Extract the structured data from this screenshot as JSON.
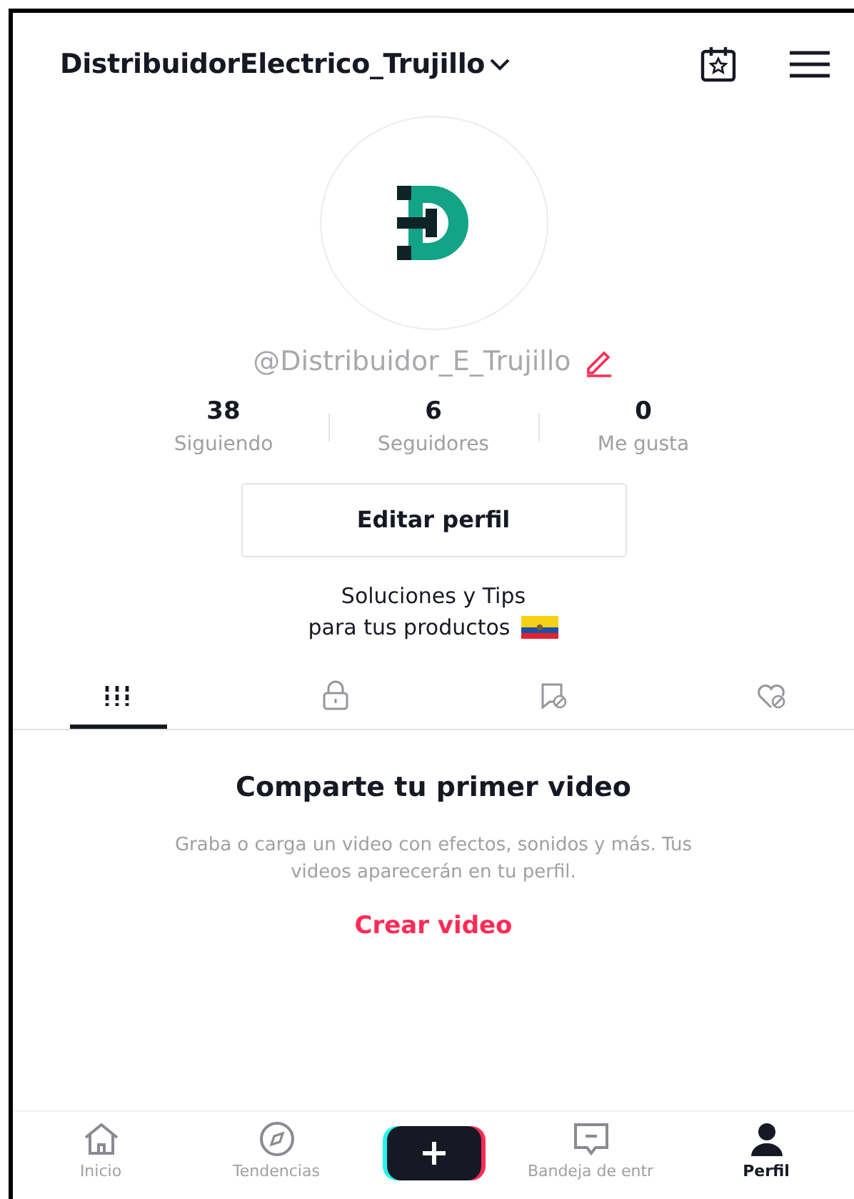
{
  "header": {
    "title": "DistribuidorElectrico_Trujillo"
  },
  "profile": {
    "handle": "@Distribuidor_E_Trujillo",
    "stats": [
      {
        "value": "38",
        "label": "Siguiendo"
      },
      {
        "value": "6",
        "label": "Seguidores"
      },
      {
        "value": "0",
        "label": "Me gusta"
      }
    ],
    "edit_button": "Editar perfil",
    "bio": [
      "Soluciones y Tips",
      "para tus productos"
    ]
  },
  "tabs": [
    {
      "kind": "videos",
      "selected": true
    },
    {
      "kind": "private",
      "selected": false
    },
    {
      "kind": "tagged",
      "selected": false
    },
    {
      "kind": "liked",
      "selected": false
    }
  ],
  "empty_state": {
    "title": "Comparte tu primer video",
    "description": "Graba o carga un video con efectos, sonidos y más. Tus videos aparecerán en tu perfil.",
    "action": "Crear video"
  },
  "bottom_nav": [
    {
      "kind": "home",
      "label": "Inicio",
      "selected": false
    },
    {
      "kind": "explore",
      "label": "Tendencias",
      "selected": false
    },
    {
      "kind": "create",
      "selected": false
    },
    {
      "kind": "inbox",
      "label": "Bandeja de entr",
      "selected": false
    },
    {
      "kind": "profile",
      "label": "Perfil",
      "selected": true
    }
  ]
}
